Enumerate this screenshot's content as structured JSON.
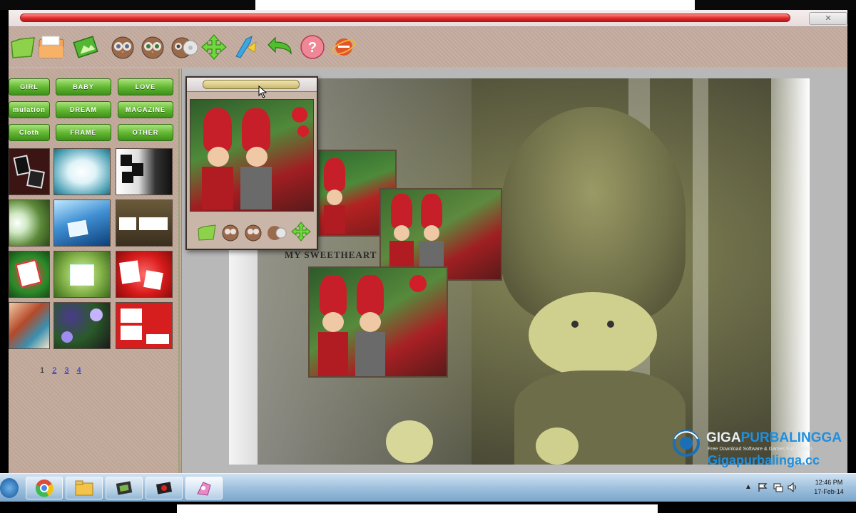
{
  "toolbar": {
    "icons": [
      "folder-open-icon",
      "folder-icon",
      "picture-icon",
      "owl-icon",
      "owl-icon",
      "owl-cd-icon",
      "move-arrows-icon",
      "brush-icon",
      "undo-icon",
      "help-icon",
      "internet-explorer-icon"
    ]
  },
  "sidebar": {
    "categories": [
      {
        "label": "GIRL"
      },
      {
        "label": "BABY"
      },
      {
        "label": "LOVE"
      },
      {
        "label": "mulation"
      },
      {
        "label": "DREAM"
      },
      {
        "label": "MAGAZINE"
      },
      {
        "label": "Cloth"
      },
      {
        "label": "FRAME"
      },
      {
        "label": "OTHER"
      }
    ],
    "pager": {
      "current": "1",
      "pages": [
        "2",
        "3",
        "4"
      ]
    }
  },
  "canvas": {
    "caption": "MY SWEETHEART"
  },
  "watermark": {
    "brand_a": "GIGA",
    "brand_b": "PURBALINGGA",
    "tagline": "Free Download Software & Games Full Version",
    "url": "Gigapurbalinga.cc"
  },
  "taskbar": {
    "apps": [
      "chrome-icon",
      "file-explorer-icon",
      "app-icon",
      "app-icon",
      "photo-app-icon"
    ],
    "clock_time": "12:46 PM",
    "clock_date": "17-Feb-14"
  },
  "colors": {
    "title_bar": "#e02a2a",
    "category_button": "#5fb52f",
    "taskbar": "#9fc1de",
    "link": "#1a2fd0"
  }
}
